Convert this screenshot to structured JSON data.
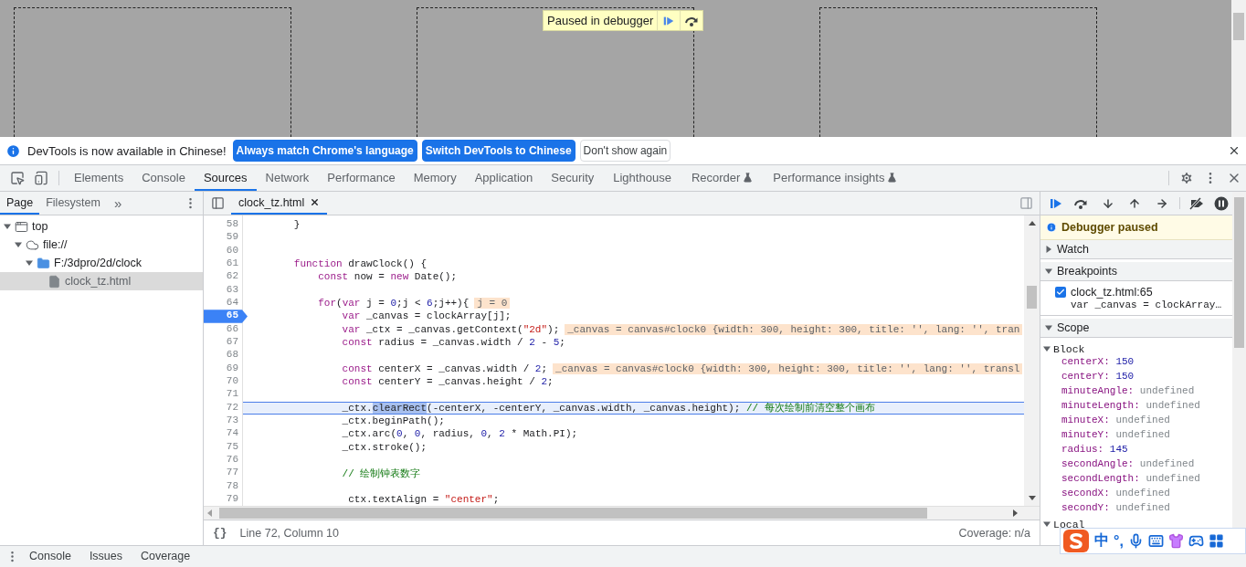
{
  "page": {
    "canvases": [
      {
        "kind": "canvas"
      },
      {
        "kind": "canvas"
      },
      {
        "kind": "canvas"
      }
    ],
    "debugger_banner": {
      "text": "Paused in debugger"
    }
  },
  "infobar": {
    "message": "DevTools is now available in Chinese!",
    "buttons": [
      {
        "label": "Always match Chrome's language",
        "kind": "primary"
      },
      {
        "label": "Switch DevTools to Chinese",
        "kind": "primary"
      },
      {
        "label": "Don't show again",
        "kind": "secondary"
      }
    ]
  },
  "main_tabs": [
    {
      "label": "Elements",
      "selected": false,
      "experimental": false
    },
    {
      "label": "Console",
      "selected": false,
      "experimental": false
    },
    {
      "label": "Sources",
      "selected": true,
      "experimental": false
    },
    {
      "label": "Network",
      "selected": false,
      "experimental": false
    },
    {
      "label": "Performance",
      "selected": false,
      "experimental": false
    },
    {
      "label": "Memory",
      "selected": false,
      "experimental": false
    },
    {
      "label": "Application",
      "selected": false,
      "experimental": false
    },
    {
      "label": "Security",
      "selected": false,
      "experimental": false
    },
    {
      "label": "Lighthouse",
      "selected": false,
      "experimental": false
    },
    {
      "label": "Recorder",
      "selected": false,
      "experimental": true
    },
    {
      "label": "Performance insights",
      "selected": false,
      "experimental": true
    }
  ],
  "navigator": {
    "tabs": [
      {
        "label": "Page",
        "selected": true
      },
      {
        "label": "Filesystem",
        "selected": false
      }
    ],
    "more": "»",
    "tree": [
      {
        "label": "top",
        "kind": "frame",
        "expanded": true,
        "selected": false,
        "children": [
          {
            "label": "file://",
            "kind": "origin",
            "expanded": true,
            "selected": false,
            "children": [
              {
                "label": "F:/3dpro/2d/clock",
                "kind": "folder",
                "expanded": true,
                "selected": false,
                "children": [
                  {
                    "label": "clock_tz.html",
                    "kind": "file",
                    "selected": true
                  }
                ]
              }
            ]
          }
        ]
      }
    ]
  },
  "editor": {
    "tabs": [
      {
        "label": "clock_tz.html",
        "selected": true
      }
    ],
    "lines": [
      {
        "number": "58",
        "breakpoint": false,
        "current": false,
        "tokens": [
          {
            "kind": "plain",
            "text": "        }"
          }
        ]
      },
      {
        "number": "59",
        "breakpoint": false,
        "current": false
      },
      {
        "number": "60",
        "breakpoint": false,
        "current": false
      },
      {
        "number": "61",
        "breakpoint": false,
        "current": false,
        "tokens": [
          {
            "kind": "keyword",
            "text": "        function"
          },
          {
            "kind": "plain",
            "text": " drawClock() {"
          }
        ]
      },
      {
        "number": "62",
        "breakpoint": false,
        "current": false,
        "tokens": [
          {
            "kind": "keyword",
            "text": "            const"
          },
          {
            "kind": "plain",
            "text": " now = "
          },
          {
            "kind": "keyword",
            "text": "new"
          },
          {
            "kind": "plain",
            "text": " Date();"
          }
        ]
      },
      {
        "number": "63",
        "breakpoint": false,
        "current": false
      },
      {
        "number": "64",
        "breakpoint": false,
        "current": false,
        "tokens": [
          {
            "kind": "keyword",
            "text": "            for"
          },
          {
            "kind": "plain",
            "text": "("
          },
          {
            "kind": "keyword",
            "text": "var"
          },
          {
            "kind": "plain",
            "text": " j = "
          },
          {
            "kind": "number",
            "text": "0"
          },
          {
            "kind": "plain",
            "text": ";j < "
          },
          {
            "kind": "number",
            "text": "6"
          },
          {
            "kind": "plain",
            "text": ";j++){"
          }
        ],
        "inline_value": "j = 0"
      },
      {
        "number": "65",
        "breakpoint": true,
        "current": false,
        "tokens": [
          {
            "kind": "keyword",
            "text": "                var"
          },
          {
            "kind": "plain",
            "text": " _canvas = clockArray[j];"
          }
        ]
      },
      {
        "number": "66",
        "breakpoint": false,
        "current": false,
        "tokens": [
          {
            "kind": "keyword",
            "text": "                var"
          },
          {
            "kind": "plain",
            "text": " _ctx = _canvas.getContext("
          },
          {
            "kind": "string",
            "text": "\"2d\""
          },
          {
            "kind": "plain",
            "text": ");"
          }
        ],
        "inline_value": "_canvas = canvas#clock0 {width: 300, height: 300, title: '', lang: '', tran"
      },
      {
        "number": "67",
        "breakpoint": false,
        "current": false,
        "tokens": [
          {
            "kind": "keyword",
            "text": "                const"
          },
          {
            "kind": "plain",
            "text": " radius = _canvas.width / "
          },
          {
            "kind": "number",
            "text": "2"
          },
          {
            "kind": "plain",
            "text": " - "
          },
          {
            "kind": "number",
            "text": "5"
          },
          {
            "kind": "plain",
            "text": ";"
          }
        ]
      },
      {
        "number": "68",
        "breakpoint": false,
        "current": false
      },
      {
        "number": "69",
        "breakpoint": false,
        "current": false,
        "tokens": [
          {
            "kind": "keyword",
            "text": "                const"
          },
          {
            "kind": "plain",
            "text": " centerX = _canvas.width / "
          },
          {
            "kind": "number",
            "text": "2"
          },
          {
            "kind": "plain",
            "text": ";"
          }
        ],
        "inline_value": "_canvas = canvas#clock0 {width: 300, height: 300, title: '', lang: '', transl"
      },
      {
        "number": "70",
        "breakpoint": false,
        "current": false,
        "tokens": [
          {
            "kind": "keyword",
            "text": "                const"
          },
          {
            "kind": "plain",
            "text": " centerY = _canvas.height / "
          },
          {
            "kind": "number",
            "text": "2"
          },
          {
            "kind": "plain",
            "text": ";"
          }
        ]
      },
      {
        "number": "71",
        "breakpoint": false,
        "current": false
      },
      {
        "number": "72",
        "breakpoint": false,
        "current": true,
        "tokens": [
          {
            "kind": "plain",
            "text": "                _ctx."
          },
          {
            "kind": "selected",
            "text": "clearRect"
          },
          {
            "kind": "plain",
            "text": "(-centerX, -centerY, _canvas.width, _canvas.height); "
          },
          {
            "kind": "comment",
            "text": "// 每次绘制前清空整个画布"
          }
        ]
      },
      {
        "number": "73",
        "breakpoint": false,
        "current": false,
        "tokens": [
          {
            "kind": "plain",
            "text": "                _ctx.beginPath();"
          }
        ]
      },
      {
        "number": "74",
        "breakpoint": false,
        "current": false,
        "tokens": [
          {
            "kind": "plain",
            "text": "                _ctx.arc("
          },
          {
            "kind": "number",
            "text": "0"
          },
          {
            "kind": "plain",
            "text": ", "
          },
          {
            "kind": "number",
            "text": "0"
          },
          {
            "kind": "plain",
            "text": ", radius, "
          },
          {
            "kind": "number",
            "text": "0"
          },
          {
            "kind": "plain",
            "text": ", "
          },
          {
            "kind": "number",
            "text": "2"
          },
          {
            "kind": "plain",
            "text": " * Math.PI);"
          }
        ]
      },
      {
        "number": "75",
        "breakpoint": false,
        "current": false,
        "tokens": [
          {
            "kind": "plain",
            "text": "                _ctx.stroke();"
          }
        ]
      },
      {
        "number": "76",
        "breakpoint": false,
        "current": false
      },
      {
        "number": "77",
        "breakpoint": false,
        "current": false,
        "tokens": [
          {
            "kind": "comment",
            "text": "                // 绘制钟表数字"
          }
        ]
      },
      {
        "number": "78",
        "breakpoint": false,
        "current": false
      },
      {
        "number": "79",
        "breakpoint": false,
        "current": false,
        "tokens": [
          {
            "kind": "plain",
            "text": "                 ctx.textAlign = "
          },
          {
            "kind": "string",
            "text": "\"center\""
          },
          {
            "kind": "plain",
            "text": ";"
          }
        ]
      }
    ],
    "status": {
      "format_button": "{}",
      "position": "Line 72, Column 10",
      "coverage": "Coverage: n/a"
    }
  },
  "debugger": {
    "paused_message": "Debugger paused",
    "sections": [
      {
        "title": "Watch",
        "expanded": false
      },
      {
        "title": "Breakpoints",
        "expanded": true,
        "kind": "breakpoints",
        "items": [
          {
            "location": "clock_tz.html:65",
            "code": "var _canvas = clockArray…",
            "checked": true
          }
        ]
      },
      {
        "title": "Scope",
        "expanded": true,
        "kind": "scope",
        "groups": [
          {
            "title": "Block",
            "expanded": true,
            "variables": [
              {
                "name": "centerX:",
                "value": "150",
                "kind": "number"
              },
              {
                "name": "centerY:",
                "value": "150",
                "kind": "number"
              },
              {
                "name": "minuteAngle:",
                "value": "undefined",
                "kind": "undefined"
              },
              {
                "name": "minuteLength:",
                "value": "undefined",
                "kind": "undefined"
              },
              {
                "name": "minuteX:",
                "value": "undefined",
                "kind": "undefined"
              },
              {
                "name": "minuteY:",
                "value": "undefined",
                "kind": "undefined"
              },
              {
                "name": "radius:",
                "value": "145",
                "kind": "number"
              },
              {
                "name": "secondAngle:",
                "value": "undefined",
                "kind": "undefined"
              },
              {
                "name": "secondLength:",
                "value": "undefined",
                "kind": "undefined"
              },
              {
                "name": "secondX:",
                "value": "undefined",
                "kind": "undefined"
              },
              {
                "name": "secondY:",
                "value": "undefined",
                "kind": "undefined"
              }
            ]
          },
          {
            "title": "Local",
            "expanded": true
          }
        ]
      }
    ]
  },
  "drawer": {
    "tabs": [
      {
        "label": "Console",
        "selected": false
      },
      {
        "label": "Issues",
        "selected": false
      },
      {
        "label": "Coverage",
        "selected": false
      }
    ]
  },
  "ime_toolbar": {
    "mode": "中",
    "punctuation": "°,"
  }
}
